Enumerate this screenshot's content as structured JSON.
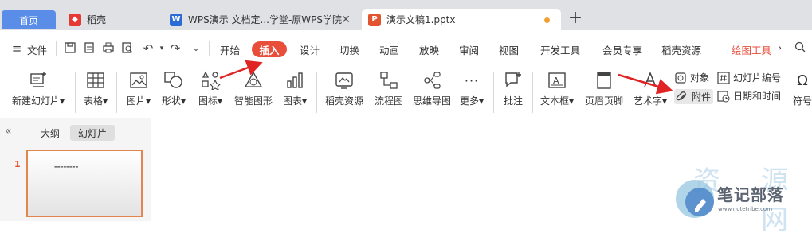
{
  "tabs": [
    {
      "label": "首页"
    },
    {
      "label": "稻壳"
    },
    {
      "label": "WPS演示 文档定...学堂-原WPS学院"
    },
    {
      "label": "演示文稿1.pptx"
    }
  ],
  "menu": {
    "file": "文件",
    "items": [
      "开始",
      "插入",
      "设计",
      "切换",
      "动画",
      "放映",
      "审阅",
      "视图",
      "开发工具",
      "会员专享",
      "稻壳资源",
      "绘图工具"
    ]
  },
  "ribbon": {
    "new_slide": "新建幻灯片",
    "table": "表格",
    "picture": "图片",
    "shape": "形状",
    "icon": "图标",
    "smart_graphic": "智能图形",
    "chart": "图表",
    "daoke_resource": "稻壳资源",
    "flowchart": "流程图",
    "mindmap": "思维导图",
    "more": "更多",
    "comment": "批注",
    "textbox": "文本框",
    "header_footer": "页眉页脚",
    "wordart": "艺术字",
    "object": "对象",
    "attachment": "附件",
    "slide_number": "幻灯片编号",
    "datetime": "日期和时间",
    "symbol": "符号"
  },
  "left_pane": {
    "outline_tab": "大纲",
    "slides_tab": "幻灯片",
    "slide_number": "1"
  },
  "watermark": {
    "title": "笔记部落",
    "url": "www.notetribe.com"
  },
  "colors": {
    "accent": "#e94e3b",
    "home_tab": "#5a8de8",
    "arrow": "#e02424"
  }
}
